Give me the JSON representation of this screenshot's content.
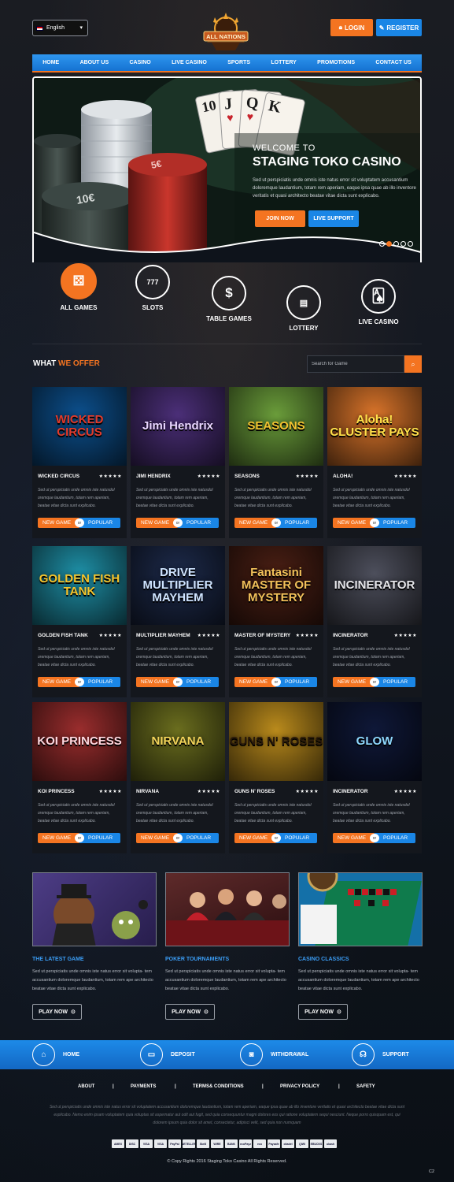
{
  "header": {
    "language": "English",
    "logo_text": "ALL NATIONS",
    "login": "LOGIN",
    "register": "REGISTER"
  },
  "nav": [
    "HOME",
    "ABOUT US",
    "CASINO",
    "LIVE CASINO",
    "SPORTS",
    "LOTTERY",
    "PROMOTIONS",
    "CONTACT US"
  ],
  "hero": {
    "subtitle": "WELCOME TO",
    "title": "STAGING TOKO CASINO",
    "text": "Sed ut perspiciatis unde omnis iste natus error sit voluptatem accusantium doloremque laudantium, totam rem aperiam, eaque ipsa quae ab illo inventore veritatis et quasi architecto beatae vitae dicta sunt explicabo.",
    "join": "JOIN NOW",
    "support": "LIVE SUPPORT",
    "slides": 5,
    "active_slide": 1
  },
  "categories": [
    {
      "label": "ALL GAMES",
      "icon": "dice-icon"
    },
    {
      "label": "SLOTS",
      "icon": "slot-777-icon"
    },
    {
      "label": "TABLE GAMES",
      "icon": "casino-chip-icon"
    },
    {
      "label": "LOTTERY",
      "icon": "lottery-ticket-icon"
    },
    {
      "label": "LIVE CASINO",
      "icon": "playing-cards-icon"
    }
  ],
  "offer": {
    "title_white": "WHAT",
    "title_orange": "WE OFFER",
    "search_placeholder": "Search for Game"
  },
  "game_common": {
    "desc": "Sed ut perspiciatis unde omnis iste natusdol oremque laudantium, totam rem aperiam, beatae vitae dicta sunt explicabo.",
    "new": "NEW GAME",
    "or": "or",
    "popular": "POPULAR",
    "stars": "★★★★★"
  },
  "games": [
    {
      "name": "WICKED CIRCUS",
      "art": "WICKED CIRCUS",
      "bg": "#0c4f8c",
      "fg": "#e23a2a"
    },
    {
      "name": "JIMI HENDRIX",
      "art": "Jimi Hendrix",
      "bg": "#4b2f78",
      "fg": "#e9d6ff"
    },
    {
      "name": "SEASONS",
      "art": "SEASONS",
      "bg": "#6a9c3a",
      "fg": "#f2c230"
    },
    {
      "name": "ALOHA!",
      "art": "Aloha! CLUSTER PAYS",
      "bg": "#d9742a",
      "fg": "#ffe14a"
    },
    {
      "name": "GOLDEN FISH TANK",
      "art": "GOLDEN FISH TANK",
      "bg": "#1e8fa6",
      "fg": "#f5c42c"
    },
    {
      "name": "MULTIPLIER MAYHEM",
      "art": "DRIVE MULTIPLIER MAYHEM",
      "bg": "#1d2a4a",
      "fg": "#cfe4ff"
    },
    {
      "name": "MASTER OF MYSTERY",
      "art": "Fantasini MASTER OF MYSTERY",
      "bg": "#4a1f14",
      "fg": "#f1c15a"
    },
    {
      "name": "INCINERATOR",
      "art": "INCINERATOR",
      "bg": "#4d4f5c",
      "fg": "#e6e6ea"
    },
    {
      "name": "KOI PRINCESS",
      "art": "KOI PRINCESS",
      "bg": "#9a2d2d",
      "fg": "#ffd8e0"
    },
    {
      "name": "NIRVANA",
      "art": "NIRVANA",
      "bg": "#6a6d1e",
      "fg": "#f3d45a"
    },
    {
      "name": "GUNS N' ROSES",
      "art": "GUNS N' ROSES",
      "bg": "#b98a1c",
      "fg": "#2a1a0a"
    },
    {
      "name": "INCINERATOR",
      "art": "GLOW",
      "bg": "#0f1838",
      "fg": "#8fd9ff"
    }
  ],
  "promos": [
    {
      "title": "THE LATEST GAME",
      "text": "Sed ut perspiciatis unde omnis iste natus error sit volupta- tem accusantium doloremque laudantium, totam rem ape architecto beatae vitae dicta sunt explicabo.",
      "button": "PLAY NOW",
      "bg": "#3b2f6e"
    },
    {
      "title": "POKER TOURNAMENTS",
      "text": "Sed ut perspiciatis unde omnis iste natus error sit volupta- tem accusantium doloremque laudantium, totam rem ape architecto beatae vitae dicta sunt explicabo.",
      "button": "PLAY NOW",
      "bg": "#5a1a1f"
    },
    {
      "title": "CASINO CLASSICS",
      "text": "Sed ut perspiciatis unde omnis iste natus error sit volupta- tem accusantium doloremque laudantium, totam rem ape architecto beatae vitae dicta sunt explicabo.",
      "button": "PLAY NOW",
      "bg": "#125a8c"
    }
  ],
  "bottom_bar": [
    {
      "label": "HOME",
      "icon": "home-icon"
    },
    {
      "label": "DEPOSIT",
      "icon": "deposit-card-icon"
    },
    {
      "label": "WITHDRAWAL",
      "icon": "withdrawal-cash-icon"
    },
    {
      "label": "SUPPORT",
      "icon": "headset-icon"
    }
  ],
  "footer": {
    "links": [
      "ABOUT",
      "PAYMENTS",
      "TERMS& CONDITIONS",
      "PRIVACY POLICY",
      "SAFETY"
    ],
    "separator": "|",
    "text": "Sed ut perspiciatis unde omnis iste natus error sit voluptatem accusantium doloremque laudantium, totam rem aperiam, eaque ipsa quae ab illo inventore veritatis et quasi architecto beatae vitae dicta sunt explicabo. Nemo enim ipsam voluptatem quia voluptas sit aspernatur aut odit aut fugit, sed quia consequuntur magni dolores eos qui ratione voluptatem sequi nesciunt. Neque porro quisquam est, qui dolorem ipsum quia dolor sit amet, consectetur, adipisci velit, sed quia non numquam",
    "payments": [
      "AMEX",
      "DISC",
      "VISA",
      "VISA",
      "PayPal",
      "NETELLER",
      "Skrill",
      "WIRE",
      "BANK",
      "ecoPayz",
      "eco",
      "Paysafe",
      "citadel",
      "QIWI",
      "EBUCKS",
      "ukash"
    ],
    "copyright": "© Copy Rights 2016 Staging Toko Casino All Rights Reserved.",
    "corner": "C2"
  },
  "colors": {
    "accent": "#f47421",
    "brand": "#1a86e6"
  }
}
